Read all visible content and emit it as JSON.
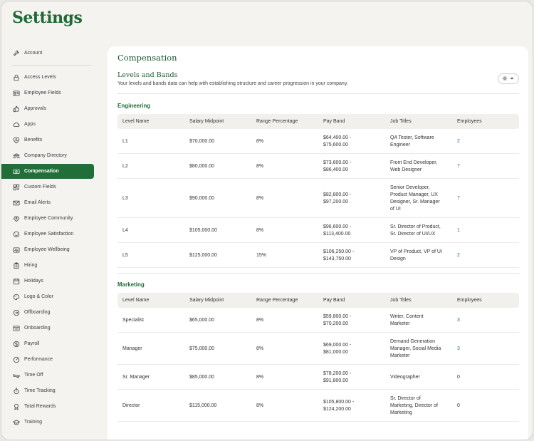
{
  "app": {
    "title": "Settings"
  },
  "sidebar": {
    "items": [
      {
        "label": "Account",
        "icon": "wrench-icon"
      },
      {
        "label": "Access Levels",
        "icon": "lock-icon"
      },
      {
        "label": "Employee Fields",
        "icon": "id-card-icon"
      },
      {
        "label": "Approvals",
        "icon": "thumbs-up-icon"
      },
      {
        "label": "Apps",
        "icon": "cloud-icon"
      },
      {
        "label": "Benefits",
        "icon": "heart-icon"
      },
      {
        "label": "Company Directory",
        "icon": "people-icon"
      },
      {
        "label": "Compensation",
        "icon": "money-icon",
        "active": true
      },
      {
        "label": "Custom Fields",
        "icon": "grid-icon"
      },
      {
        "label": "Email Alerts",
        "icon": "mail-icon"
      },
      {
        "label": "Employee Community",
        "icon": "community-icon"
      },
      {
        "label": "Employee Satisfaction",
        "icon": "smile-icon"
      },
      {
        "label": "Employee Wellbeing",
        "icon": "wellbeing-icon"
      },
      {
        "label": "Hiring",
        "icon": "clipboard-icon"
      },
      {
        "label": "Holidays",
        "icon": "calendar-icon"
      },
      {
        "label": "Logo & Color",
        "icon": "palette-icon"
      },
      {
        "label": "Offboarding",
        "icon": "offboarding-icon"
      },
      {
        "label": "Onboarding",
        "icon": "onboarding-icon"
      },
      {
        "label": "Payroll",
        "icon": "dollar-icon"
      },
      {
        "label": "Performance",
        "icon": "gauge-icon"
      },
      {
        "label": "Time Off",
        "icon": "plane-icon"
      },
      {
        "label": "Time Tracking",
        "icon": "stopwatch-icon"
      },
      {
        "label": "Total Rewards",
        "icon": "award-icon"
      },
      {
        "label": "Training",
        "icon": "graduation-icon"
      }
    ]
  },
  "main": {
    "title": "Compensation",
    "section_title": "Levels and Bands",
    "section_desc": "Your levels and bands data can help with establishing structure and career progression in your company.",
    "columns": [
      "Level Name",
      "Salary Midpoint",
      "Range Percentage",
      "Pay Band",
      "Job Titles",
      "Employees"
    ],
    "groups": [
      {
        "name": "Engineering",
        "rows": [
          {
            "level": "L1",
            "midpoint": "$70,000.00",
            "range": "8%",
            "band": [
              "$64,400.00 -",
              "$75,600.00"
            ],
            "titles": [
              "QA Tester, Software",
              "Engineer"
            ],
            "employees": "2"
          },
          {
            "level": "L2",
            "midpoint": "$80,000.00",
            "range": "8%",
            "band": [
              "$73,600.00 -",
              "$86,400.00"
            ],
            "titles": [
              "Front End Developer,",
              "Web Designer"
            ],
            "employees": "7"
          },
          {
            "level": "L3",
            "midpoint": "$90,000.00",
            "range": "8%",
            "band": [
              "$82,800.00 -",
              "$97,200.00"
            ],
            "titles": [
              "Senior Developer,",
              "Product Manager, UX",
              "Designer, Sr. Manager",
              "of UI"
            ],
            "employees": "7"
          },
          {
            "level": "L4",
            "midpoint": "$105,000.00",
            "range": "8%",
            "band": [
              "$96,600.00 -",
              "$113,400.00"
            ],
            "titles": [
              "Sr. Director of Product,",
              "Sr. Director of UI/UX"
            ],
            "employees": "1"
          },
          {
            "level": "L5",
            "midpoint": "$125,000.00",
            "range": "15%",
            "band": [
              "$106,250.00 -",
              "$143,750.00"
            ],
            "titles": [
              "VP of Product, VP of UI",
              "Design"
            ],
            "employees": "2"
          }
        ]
      },
      {
        "name": "Marketing",
        "rows": [
          {
            "level": "Specialist",
            "midpoint": "$65,000.00",
            "range": "8%",
            "band": [
              "$59,800.00 -",
              "$70,200.00"
            ],
            "titles": [
              "Writer, Content",
              "Marketer"
            ],
            "employees": "3"
          },
          {
            "level": "Manager",
            "midpoint": "$75,000.00",
            "range": "8%",
            "band": [
              "$69,000.00 -",
              "$81,000.00"
            ],
            "titles": [
              "Demand Generation",
              "Manager, Social Media",
              "Marketer"
            ],
            "employees": "3"
          },
          {
            "level": "Sr. Manager",
            "midpoint": "$85,000.00",
            "range": "8%",
            "band": [
              "$78,200.00 -",
              "$91,800.00"
            ],
            "titles": [
              "Videographer"
            ],
            "employees": "0"
          },
          {
            "level": "Director",
            "midpoint": "$115,000.00",
            "range": "8%",
            "band": [
              "$105,800.00 -",
              "$124,200.00"
            ],
            "titles": [
              "Sr. Director of",
              "Marketing, Director of",
              "Marketing"
            ],
            "employees": "0"
          }
        ]
      }
    ]
  },
  "colors": {
    "brand": "#226e39",
    "link": "#2a6fb0"
  }
}
